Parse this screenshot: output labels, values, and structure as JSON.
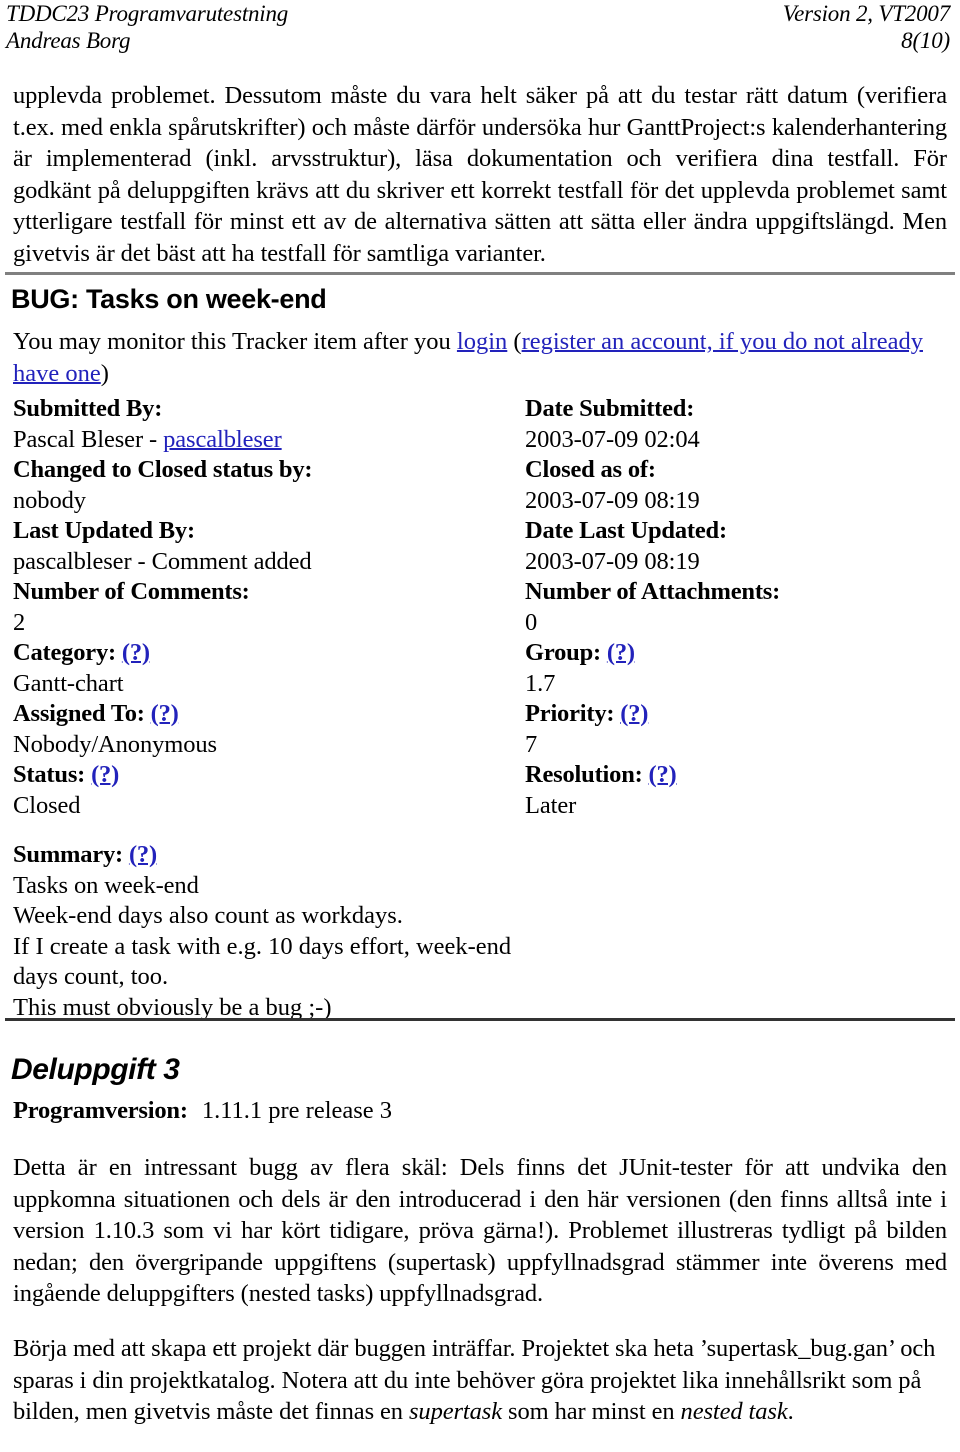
{
  "header": {
    "course": "TDDC23 Programvarutestning",
    "version": "Version 2, VT2007",
    "author": "Andreas Borg",
    "page": "8(10)"
  },
  "intro_paragraph": {
    "line1": "upplevda problemet. Dessutom måste du vara helt säker på att du testar rätt datum",
    "line2": "(verifiera t.ex. med enkla spårutskrifter) och måste därför undersöka hur GanttProject:s",
    "line3": "kalenderhantering är implementerad (inkl. arvsstruktur), läsa dokumentation och verifiera",
    "line4": "dina testfall. För godkänt på deluppgiften krävs att du skriver ett korrekt testfall för det",
    "line5": "upplevda problemet samt ytterligare testfall för minst ett av de alternativa sätten att sätta",
    "line6": "eller ändra uppgiftslängd. Men givetvis är det bäst att ha testfall för samtliga varianter."
  },
  "bug": {
    "title": "BUG: Tasks on week-end",
    "monitor_text_before": "You may monitor this Tracker item after you ",
    "login_link": "login",
    "monitor_text_mid": " (",
    "register_link": "register an account, if you do not already have one",
    "monitor_text_after": ")",
    "fields": [
      {
        "left_label": "Submitted By:",
        "left_value": "Pascal Bleser - ",
        "left_value_link": "pascalbleser",
        "right_label": "Date Submitted:",
        "right_value": "2003-07-09 02:04"
      },
      {
        "left_label": "Changed to Closed status by:",
        "left_value": "nobody",
        "right_label": "Closed as of:",
        "right_value": "2003-07-09 08:19"
      },
      {
        "left_label": "Last Updated By:",
        "left_value": "pascalbleser - Comment added",
        "right_label": "Date Last Updated:",
        "right_value": "2003-07-09 08:19"
      },
      {
        "left_label": "Number of Comments:",
        "left_value": "2",
        "right_label": "Number of Attachments:",
        "right_value": "0"
      },
      {
        "left_label": "Category:",
        "left_help": "(?)",
        "left_value": "Gantt-chart",
        "right_label": "Group:",
        "right_help": "(?)",
        "right_value": "1.7"
      },
      {
        "left_label": "Assigned To:",
        "left_help": "(?)",
        "left_value": "Nobody/Anonymous",
        "right_label": "Priority:",
        "right_help": "(?)",
        "right_value": "7"
      },
      {
        "left_label": "Status:",
        "left_help": "(?)",
        "left_value": "Closed",
        "right_label": "Resolution:",
        "right_help": "(?)",
        "right_value": "Later"
      }
    ],
    "summary_label": "Summary:",
    "summary_help": "(?)",
    "summary_value": "Tasks on week-end",
    "description_lines": [
      "Week-end days also count as workdays.",
      "If I create a task with e.g. 10 days effort, week-end",
      "days count, too.",
      "This must obviously be a bug ;-)"
    ]
  },
  "section": {
    "heading": "Deluppgift 3",
    "progver_label": "Programversion:",
    "progver_value": "1.11.1 pre release 3"
  },
  "body_paragraph_1": {
    "line1": "Detta är en intressant bugg av flera skäl: Dels finns det JUnit-tester för att undvika den",
    "line2": "uppkomna situationen och dels är den introducerad i den här versionen (den finns alltså",
    "line3": "inte i version 1.10.3 som vi har kört tidigare, pröva gärna!). Problemet illustreras tydligt",
    "line4": "på bilden nedan; den övergripande uppgiftens (supertask) uppfyllnadsgrad stämmer inte",
    "line5": "överens med ingående deluppgifters (nested tasks) uppfyllnadsgrad."
  },
  "body_paragraph_2": {
    "line1": "Börja med att skapa ett projekt där buggen inträffar. Projektet ska heta",
    "line2": "’supertask_bug.gan’ och sparas i din projektkatalog. Notera att du inte behöver göra",
    "line3a": "projektet lika innehållsrikt som på bilden, men givetvis måste det finnas en ",
    "line3b": "supertask",
    "line3c": " som",
    "line4a": "har minst en ",
    "line4b": "nested task",
    "line4c": "."
  },
  "colors": {
    "link": "#2222bb",
    "rule_gray": "#808080",
    "text": "#000000"
  }
}
